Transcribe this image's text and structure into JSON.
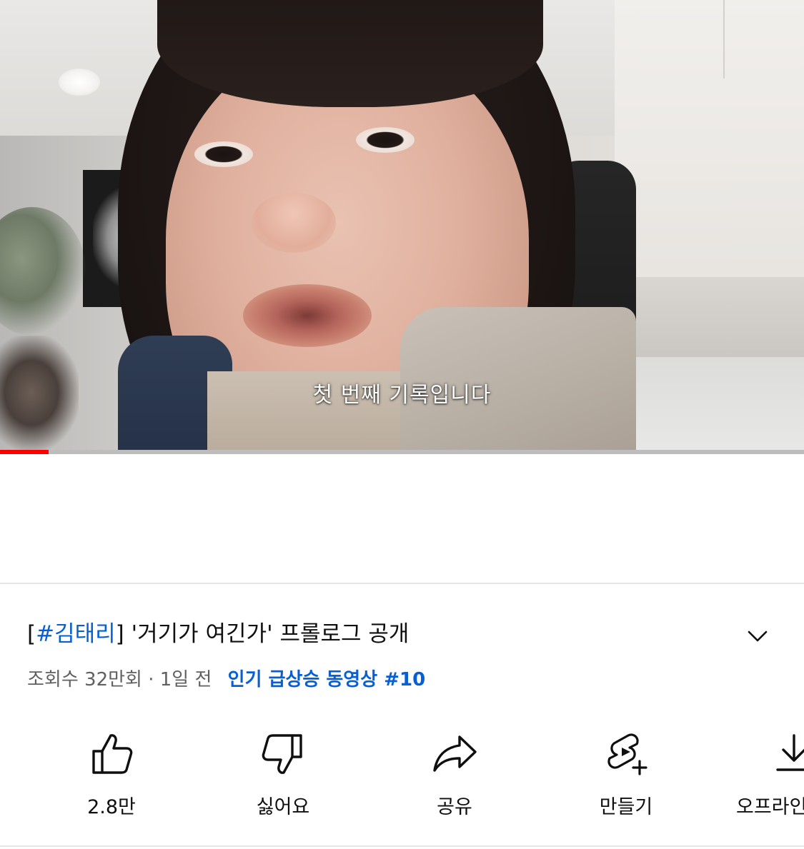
{
  "video": {
    "subtitle": "첫 번째 기록입니다",
    "progress": 0.06,
    "accent": "#ff0000"
  },
  "details": {
    "title_prefix_open": "[",
    "title_hashtag": "#김태리",
    "title_rest": "] '거기가 여긴가' 프롤로그 공개",
    "views": "조회수 32만회",
    "separator": "·",
    "age": "1일 전",
    "trending": "인기 급상승 동영상 #10",
    "expand_icon": "chevron-down-icon",
    "link_color": "#065fd4"
  },
  "actions": {
    "like": {
      "label": "2.8만",
      "icon": "thumbs-up-icon"
    },
    "dislike": {
      "label": "싫어요",
      "icon": "thumbs-down-icon"
    },
    "share": {
      "label": "공유",
      "icon": "share-icon"
    },
    "create": {
      "label": "만들기",
      "icon": "shorts-create-icon"
    },
    "offline": {
      "label": "오프라인",
      "icon": "download-icon"
    }
  }
}
